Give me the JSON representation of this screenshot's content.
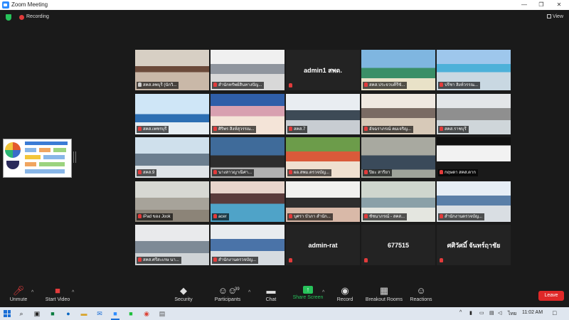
{
  "window": {
    "title": "Zoom Meeting",
    "minimize": "—",
    "restore": "❐",
    "close": "✕"
  },
  "infobar": {
    "recording_label": "Recording",
    "view_label": "View"
  },
  "tiles": [
    {
      "label": "สคส.ลพบุรี (นักวิ...",
      "type": "video",
      "active": true,
      "muted": false
    },
    {
      "label": "สำนักทรัพย์สินทางปัญ...",
      "type": "video",
      "active": false,
      "muted": true
    },
    {
      "name": "admin1 สพด.",
      "type": "name",
      "active": false,
      "muted": true
    },
    {
      "label": "สคส.ประจวบคีรีขั...",
      "type": "video",
      "active": false,
      "muted": true
    },
    {
      "label": "ปรีชา สิงห์วรรณ...",
      "type": "video",
      "active": false,
      "muted": true
    },
    {
      "label": "สคส.เพชรบุรี",
      "type": "video",
      "active": false,
      "muted": true
    },
    {
      "label": "ศิริพร สิงห์สุวรรณ...",
      "type": "video",
      "active": false,
      "muted": true
    },
    {
      "label": "สคส.7",
      "type": "video",
      "active": false,
      "muted": true
    },
    {
      "label": "อัจฉราภรณ์ คมเจริญ...",
      "type": "video",
      "active": false,
      "muted": true
    },
    {
      "label": "สคส.ราชบุรี",
      "type": "video",
      "active": false,
      "muted": true
    },
    {
      "label": "สคส.9",
      "type": "video",
      "active": false,
      "muted": true
    },
    {
      "label": "นางสาวญาณิศา...",
      "type": "video",
      "active": false,
      "muted": true
    },
    {
      "label": "ผอ.สพม.ตรวจบัญ...",
      "type": "video",
      "active": false,
      "muted": true
    },
    {
      "label": "ปิยะ สาริยา",
      "type": "video",
      "active": false,
      "muted": true
    },
    {
      "label": "กฤษดา สคส.ตาก",
      "type": "video",
      "active": false,
      "muted": true
    },
    {
      "label": "iPad ของ Jook",
      "type": "video",
      "active": false,
      "muted": true
    },
    {
      "label": "acer",
      "type": "video",
      "active": false,
      "muted": true
    },
    {
      "label": "บุศรา บัวภา สำนัก...",
      "type": "video",
      "active": false,
      "muted": true
    },
    {
      "label": "ชัชนาภรณ์ - สคส...",
      "type": "video",
      "active": false,
      "muted": true
    },
    {
      "label": "สำนักงานตรวจบัญ...",
      "type": "video",
      "active": false,
      "muted": true
    },
    {
      "label": "สคส.ศรีสะเกษ นา...",
      "type": "video",
      "active": false,
      "muted": true
    },
    {
      "label": "สำนักงานตรวจบัญ...",
      "type": "video",
      "active": false,
      "muted": true
    },
    {
      "name": "admin-rat",
      "type": "name",
      "active": false,
      "muted": true
    },
    {
      "name": "677515",
      "type": "name",
      "active": false,
      "muted": true
    },
    {
      "name": "ศศิวัศมิ์ จันทร์ฤาชัย",
      "type": "name",
      "active": false,
      "muted": true
    }
  ],
  "toolbar": {
    "unmute": "Unmute",
    "start_video": "Start Video",
    "security": "Security",
    "participants": "Participants",
    "participants_count": "39",
    "chat": "Chat",
    "share_screen": "Share Screen",
    "record": "Record",
    "breakout_rooms": "Breakout Rooms",
    "reactions": "Reactions",
    "leave": "Leave"
  },
  "taskbar": {
    "time": "11:02 AM",
    "language": "ไทย",
    "caret": "^"
  },
  "colors": {
    "accent_green": "#27c25a",
    "leave_red": "#e02828",
    "active_speaker": "#b9e22a"
  }
}
